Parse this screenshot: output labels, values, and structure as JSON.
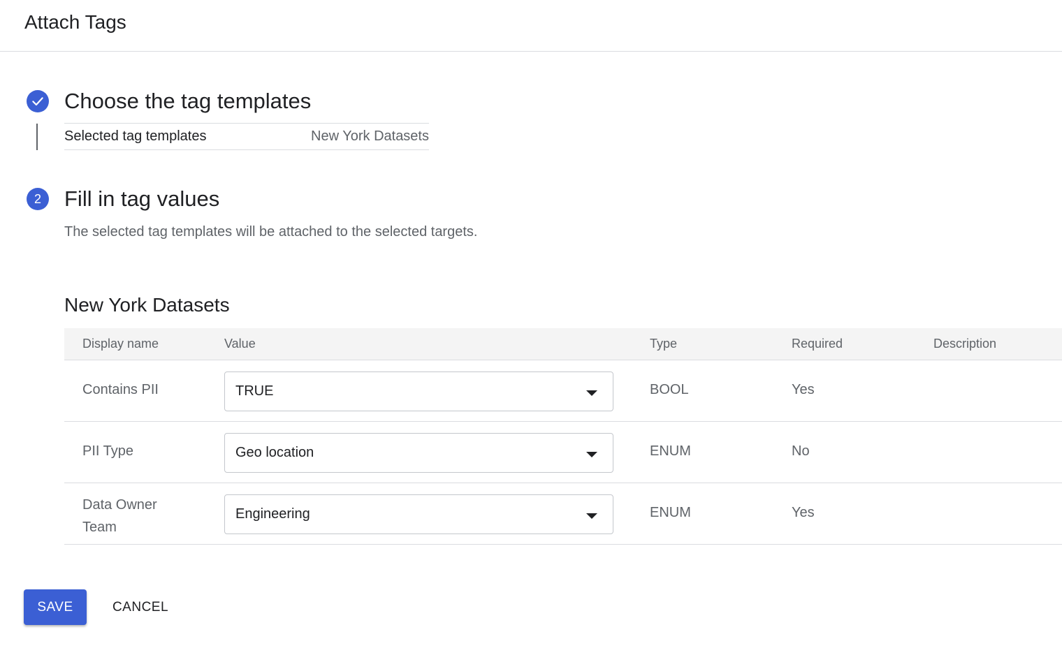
{
  "header": {
    "title": "Attach Tags"
  },
  "step1": {
    "title": "Choose the tag templates",
    "summary_label": "Selected tag templates",
    "summary_value": "New York Datasets",
    "status_icon": "check-icon"
  },
  "step2": {
    "number": "2",
    "title": "Fill in tag values",
    "description": "The selected tag templates will be attached to the selected targets."
  },
  "template": {
    "title": "New York Datasets",
    "columns": [
      "Display name",
      "Value",
      "Type",
      "Required",
      "Description"
    ],
    "rows": [
      {
        "name": "Contains PII",
        "value": "TRUE",
        "type": "BOOL",
        "required": "Yes",
        "description": ""
      },
      {
        "name": "PII Type",
        "value": "Geo location",
        "type": "ENUM",
        "required": "No",
        "description": ""
      },
      {
        "name": "Data Owner Team",
        "value": "Engineering",
        "type": "ENUM",
        "required": "Yes",
        "description": ""
      }
    ]
  },
  "actions": {
    "save": "SAVE",
    "cancel": "CANCEL"
  },
  "colors": {
    "accent": "#3b5fd4"
  }
}
